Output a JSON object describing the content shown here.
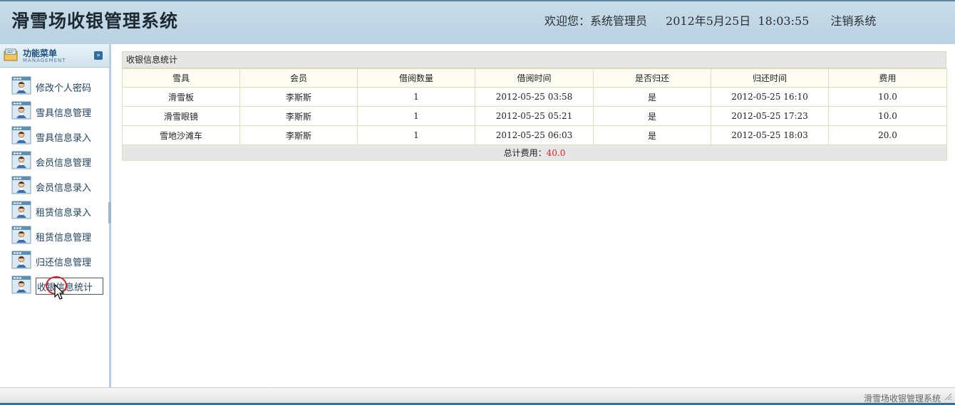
{
  "header": {
    "title": "滑雪场收银管理系统",
    "welcome_label": "欢迎您：",
    "user_name": "系统管理员",
    "date_time": "2012年5月25日  18:03:55",
    "logout": "注销系统"
  },
  "sidebar": {
    "title": "功能菜单",
    "subtitle": "MANAGEMENT",
    "collapse_icon": "double-chevron-down-icon",
    "items": [
      {
        "label": "修改个人密码",
        "icon": "user-card-icon"
      },
      {
        "label": "雪具信息管理",
        "icon": "user-card-icon"
      },
      {
        "label": "雪具信息录入",
        "icon": "user-card-icon"
      },
      {
        "label": "会员信息管理",
        "icon": "user-card-icon"
      },
      {
        "label": "会员信息录入",
        "icon": "user-card-icon"
      },
      {
        "label": "租赁信息录入",
        "icon": "user-card-icon"
      },
      {
        "label": "租赁信息管理",
        "icon": "user-card-icon"
      },
      {
        "label": "归还信息管理",
        "icon": "user-card-icon"
      },
      {
        "label": "收银信息统计",
        "icon": "user-card-icon",
        "active": true
      }
    ]
  },
  "panel": {
    "title": "收银信息统计",
    "columns": [
      "雪具",
      "会员",
      "借阅数量",
      "借阅时间",
      "是否归还",
      "归还时间",
      "费用"
    ],
    "rows": [
      [
        "滑雪板",
        "李斯斯",
        "1",
        "2012-05-25 03:58",
        "是",
        "2012-05-25 16:10",
        "10.0"
      ],
      [
        "滑雪眼镜",
        "李斯斯",
        "1",
        "2012-05-25 05:21",
        "是",
        "2012-05-25 17:23",
        "10.0"
      ],
      [
        "雪地沙滩车",
        "李斯斯",
        "1",
        "2012-05-25 06:03",
        "是",
        "2012-05-25 18:03",
        "20.0"
      ]
    ],
    "total_label": "总计费用：",
    "total_value": "40.0"
  },
  "footer": {
    "text": "滑雪场收银管理系统"
  },
  "colors": {
    "header_bg": "#c1d7e5",
    "total_value": "#e02020",
    "sidebar_border": "#b9cfdd"
  }
}
